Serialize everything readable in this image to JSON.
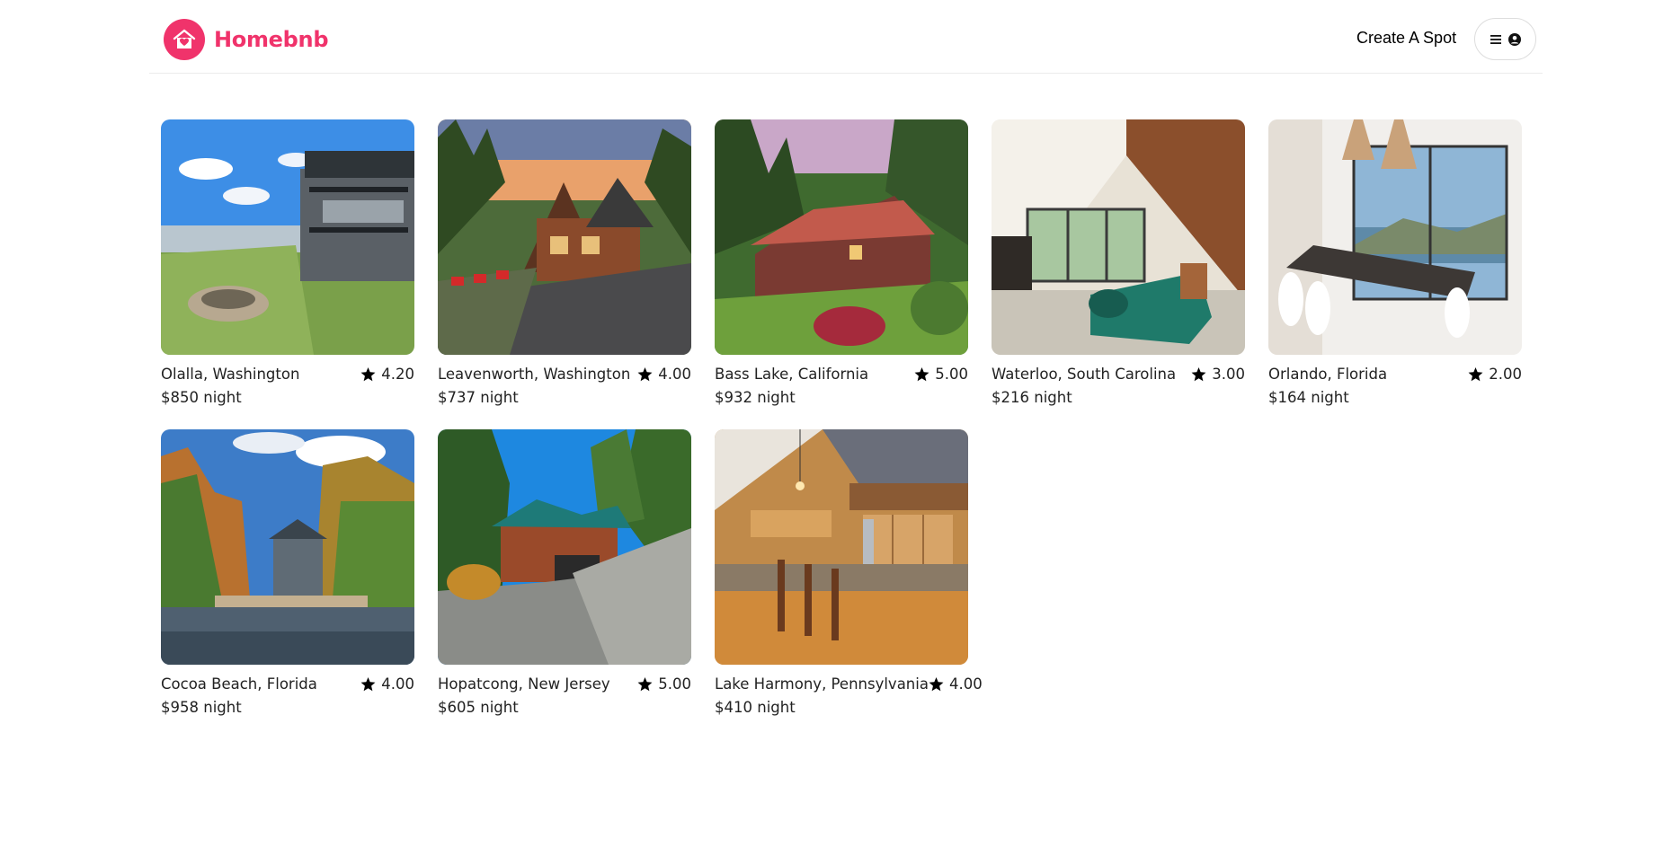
{
  "header": {
    "brand": "Homebnb",
    "create_spot_label": "Create A Spot",
    "menu_icon": "hamburger-menu-icon",
    "profile_icon": "user-circle-icon",
    "brand_color": "#f0336b"
  },
  "spots": [
    {
      "location": "Olalla, Washington",
      "rating": "4.20",
      "price": "$850 night",
      "scene": "lakeside deck house"
    },
    {
      "location": "Leavenworth, Washington",
      "rating": "4.00",
      "price": "$737 night",
      "scene": "log cabin at sunset"
    },
    {
      "location": "Bass Lake, California",
      "rating": "5.00",
      "price": "$932 night",
      "scene": "red-roof house in garden"
    },
    {
      "location": "Waterloo, South Carolina",
      "rating": "3.00",
      "price": "$216 night",
      "scene": "living room with green sofa"
    },
    {
      "location": "Orlando, Florida",
      "rating": "2.00",
      "price": "$164 night",
      "scene": "dining room with lake view"
    },
    {
      "location": "Cocoa Beach, Florida",
      "rating": "4.00",
      "price": "$958 night",
      "scene": "lake house in autumn trees"
    },
    {
      "location": "Hopatcong, New Jersey",
      "rating": "5.00",
      "price": "$605 night",
      "scene": "cabin with driveway"
    },
    {
      "location": "Lake Harmony, Pennsylvania",
      "rating": "4.00",
      "price": "$410 night",
      "scene": "wood kitchen interior"
    }
  ],
  "icons": {
    "rating": "star-icon"
  }
}
